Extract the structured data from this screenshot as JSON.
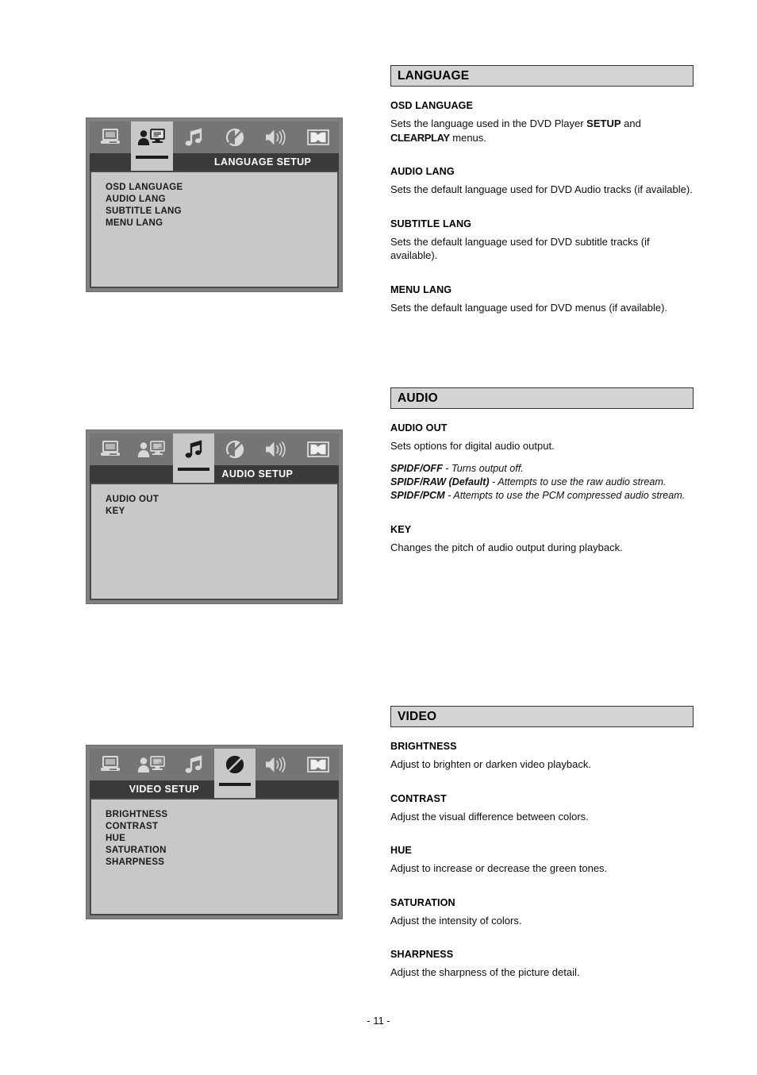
{
  "page": {
    "number_label": "- 11 -"
  },
  "osd_widgets": [
    {
      "id": "language-setup",
      "title": "LANGUAGE SETUP",
      "active_tab_index": 1,
      "label_position": "right",
      "tabs": [
        {
          "icon": "monitor-icon",
          "name": "general-setup-tab"
        },
        {
          "icon": "person-display-icon",
          "name": "language-setup-tab"
        },
        {
          "icon": "music-note-icon",
          "name": "audio-setup-tab"
        },
        {
          "icon": "contrast-circle-icon",
          "name": "video-setup-tab"
        },
        {
          "icon": "speaker-icon",
          "name": "speaker-setup-tab"
        },
        {
          "icon": "dolby-digital-icon",
          "name": "digital-setup-tab"
        }
      ],
      "items": [
        "OSD LANGUAGE",
        "AUDIO LANG",
        "SUBTITLE LANG",
        "MENU LANG"
      ]
    },
    {
      "id": "audio-setup",
      "title": "AUDIO SETUP",
      "active_tab_index": 2,
      "label_position": "right",
      "tabs": [
        {
          "icon": "monitor-icon",
          "name": "general-setup-tab"
        },
        {
          "icon": "person-display-icon",
          "name": "language-setup-tab"
        },
        {
          "icon": "music-note-icon",
          "name": "audio-setup-tab"
        },
        {
          "icon": "contrast-circle-icon",
          "name": "video-setup-tab"
        },
        {
          "icon": "speaker-icon",
          "name": "speaker-setup-tab"
        },
        {
          "icon": "dolby-digital-icon",
          "name": "digital-setup-tab"
        }
      ],
      "items": [
        "AUDIO OUT",
        "KEY"
      ]
    },
    {
      "id": "video-setup",
      "title": "VIDEO SETUP",
      "active_tab_index": 3,
      "label_position": "left",
      "tabs": [
        {
          "icon": "monitor-icon",
          "name": "general-setup-tab"
        },
        {
          "icon": "person-display-icon",
          "name": "language-setup-tab"
        },
        {
          "icon": "music-note-icon",
          "name": "audio-setup-tab"
        },
        {
          "icon": "contrast-circle-icon",
          "name": "video-setup-tab"
        },
        {
          "icon": "speaker-icon",
          "name": "speaker-setup-tab"
        },
        {
          "icon": "dolby-digital-icon",
          "name": "digital-setup-tab"
        }
      ],
      "items": [
        "BRIGHTNESS",
        "CONTRAST",
        "HUE",
        "SATURATION",
        "SHARPNESS"
      ]
    }
  ],
  "sections": {
    "language": {
      "heading": "LANGUAGE",
      "entries": [
        {
          "title": "OSD LANGUAGE",
          "body_part1": "Sets the language used in the DVD Player ",
          "body_bold1": "SETUP",
          "body_part2": " and ",
          "body_bold2": "CLEARPLAY",
          "body_part3": " menus."
        },
        {
          "title": "AUDIO LANG",
          "body": "Sets the default language used for DVD Audio tracks (if available)."
        },
        {
          "title": "SUBTITLE LANG",
          "body": "Sets the default language used for DVD subtitle tracks (if available)."
        },
        {
          "title": "MENU LANG",
          "body": "Sets the default language used for DVD menus (if available)."
        }
      ]
    },
    "audio": {
      "heading": "AUDIO",
      "entries": [
        {
          "title": "AUDIO OUT",
          "body": "Sets options for digital audio output.",
          "options": [
            {
              "name": "SPIDF/OFF",
              "desc": " - Turns output off."
            },
            {
              "name": "SPIDF/RAW (Default)",
              "desc": " - Attempts to use the raw audio stream."
            },
            {
              "name": "SPIDF/PCM",
              "desc": " - Attempts to use the PCM compressed audio stream."
            }
          ]
        },
        {
          "title": "KEY",
          "body": "Changes the pitch of audio output during playback."
        }
      ]
    },
    "video": {
      "heading": "VIDEO",
      "entries": [
        {
          "title": "BRIGHTNESS",
          "body": "Adjust to brighten or darken video playback."
        },
        {
          "title": "CONTRAST",
          "body": "Adjust the visual difference between colors."
        },
        {
          "title": "HUE",
          "body": "Adjust to increase or decrease the green tones."
        },
        {
          "title": "SATURATION",
          "body": "Adjust the intensity of colors."
        },
        {
          "title": "SHARPNESS",
          "body": "Adjust the sharpness of the picture detail."
        }
      ]
    }
  },
  "colors": {
    "osd_frame": "#808080",
    "osd_bar": "#757575",
    "osd_label_row": "#3a3a3a",
    "osd_panel": "#c8c8c8",
    "section_header_bg": "#d4d4d4",
    "icon": "#d8d8d8",
    "icon_active": "#1c1c1c"
  }
}
